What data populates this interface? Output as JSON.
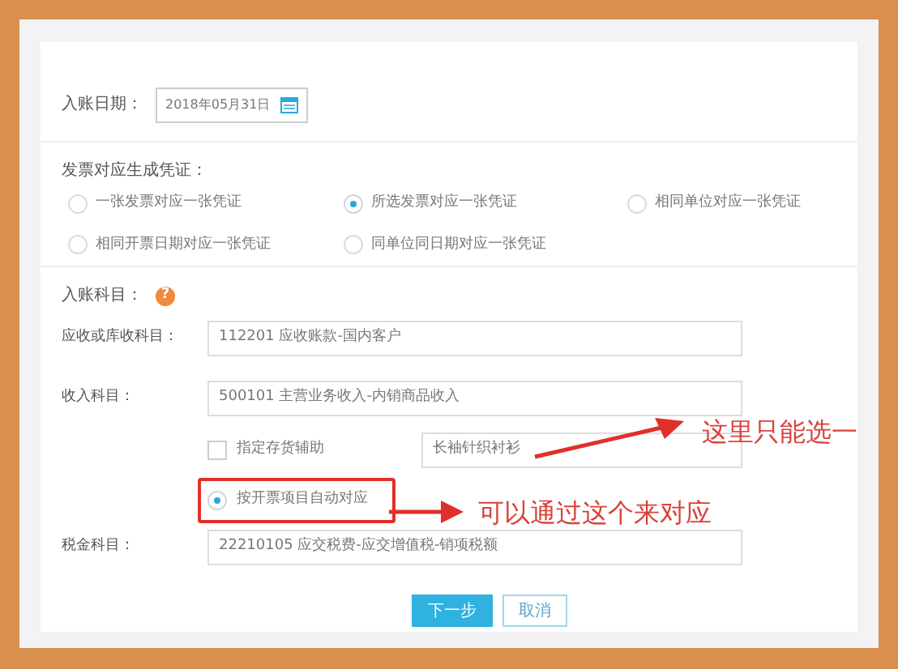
{
  "entry_date": {
    "label": "入账日期：",
    "value": "2018年05月31日"
  },
  "voucher_mode": {
    "label": "发票对应生成凭证：",
    "options": [
      {
        "label": "一张发票对应一张凭证",
        "selected": false
      },
      {
        "label": "所选发票对应一张凭证",
        "selected": true
      },
      {
        "label": "相同单位对应一张凭证",
        "selected": false
      },
      {
        "label": "相同开票日期对应一张凭证",
        "selected": false
      },
      {
        "label": "同单位同日期对应一张凭证",
        "selected": false
      }
    ]
  },
  "accounts": {
    "label": "入账科目：",
    "help_icon": "?",
    "receivable": {
      "label": "应收或库收科目：",
      "value": "112201 应收账款-国内客户"
    },
    "income": {
      "label": "收入科目：",
      "value": "500101 主营业务收入-内销商品收入"
    },
    "inventory_aux": {
      "label": "指定存货辅助",
      "checked": false,
      "value": "长袖针织衬衫"
    },
    "auto_match": {
      "label": "按开票项目自动对应",
      "selected": true
    },
    "tax": {
      "label": "税金科目：",
      "value": "22210105 应交税费-应交增值税-销项税额"
    }
  },
  "buttons": {
    "next": "下一步",
    "cancel": "取消"
  },
  "annotations": [
    "这里只能选一",
    "可以通过这个来对应"
  ]
}
